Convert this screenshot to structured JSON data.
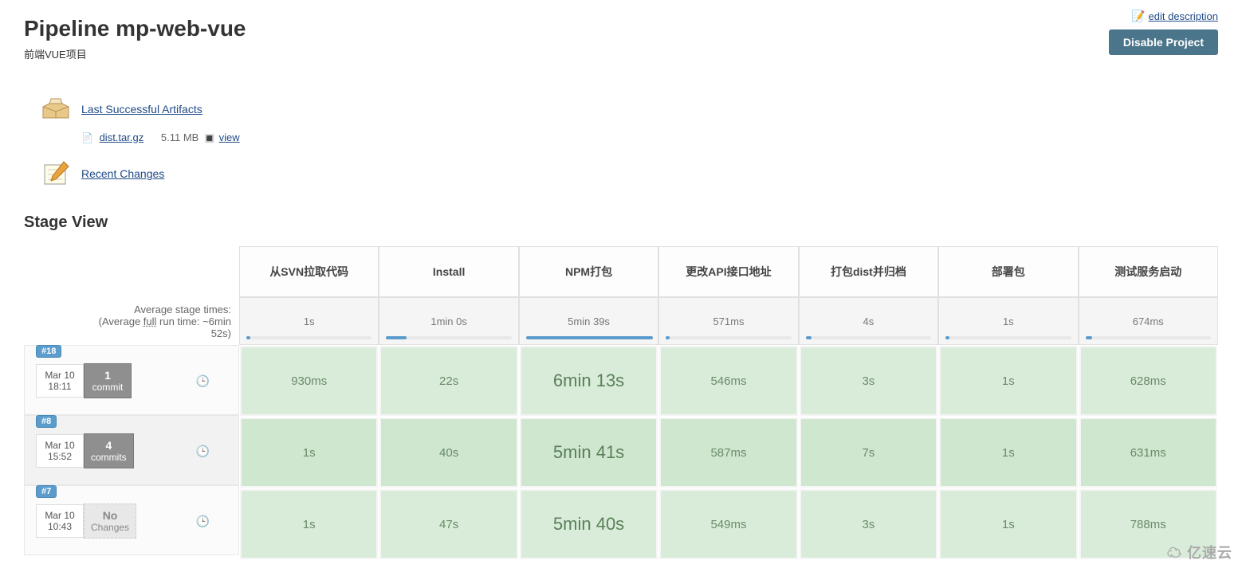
{
  "header": {
    "title": "Pipeline mp-web-vue",
    "description": "前端VUE项目",
    "edit_description": "edit description",
    "disable_button": "Disable Project"
  },
  "links": {
    "artifacts_title": "Last Successful Artifacts",
    "artifact_file": "dist.tar.gz",
    "artifact_size": "5.11 MB",
    "artifact_view": "view",
    "recent_changes": "Recent Changes"
  },
  "stage_view": {
    "title": "Stage View",
    "avg_label_1": "Average stage times:",
    "avg_label_2a": "(Average ",
    "avg_label_2b": "full",
    "avg_label_2c": " run time: ~6min",
    "avg_label_3": "52s)",
    "stages": [
      "从SVN拉取代码",
      "Install",
      "NPM打包",
      "更改API接口地址",
      "打包dist并归档",
      "部署包",
      "测试服务启动"
    ],
    "averages": [
      "1s",
      "1min 0s",
      "5min 39s",
      "571ms",
      "4s",
      "1s",
      "674ms"
    ],
    "avg_bar_pct": [
      3,
      15,
      92,
      3,
      4,
      3,
      5
    ],
    "builds": [
      {
        "badge": "#18",
        "date": "Mar 10",
        "time": "18:11",
        "commits_n": "1",
        "commits_label": "commit",
        "cells": [
          "930ms",
          "22s",
          "6min 13s",
          "546ms",
          "3s",
          "1s",
          "628ms"
        ]
      },
      {
        "badge": "#8",
        "date": "Mar 10",
        "time": "15:52",
        "commits_n": "4",
        "commits_label": "commits",
        "cells": [
          "1s",
          "40s",
          "5min 41s",
          "587ms",
          "7s",
          "1s",
          "631ms"
        ]
      },
      {
        "badge": "#7",
        "date": "Mar 10",
        "time": "10:43",
        "commits_n": "No",
        "commits_label": "Changes",
        "none": true,
        "cells": [
          "1s",
          "47s",
          "5min 40s",
          "549ms",
          "3s",
          "1s",
          "788ms"
        ]
      }
    ]
  },
  "brand": "亿速云"
}
